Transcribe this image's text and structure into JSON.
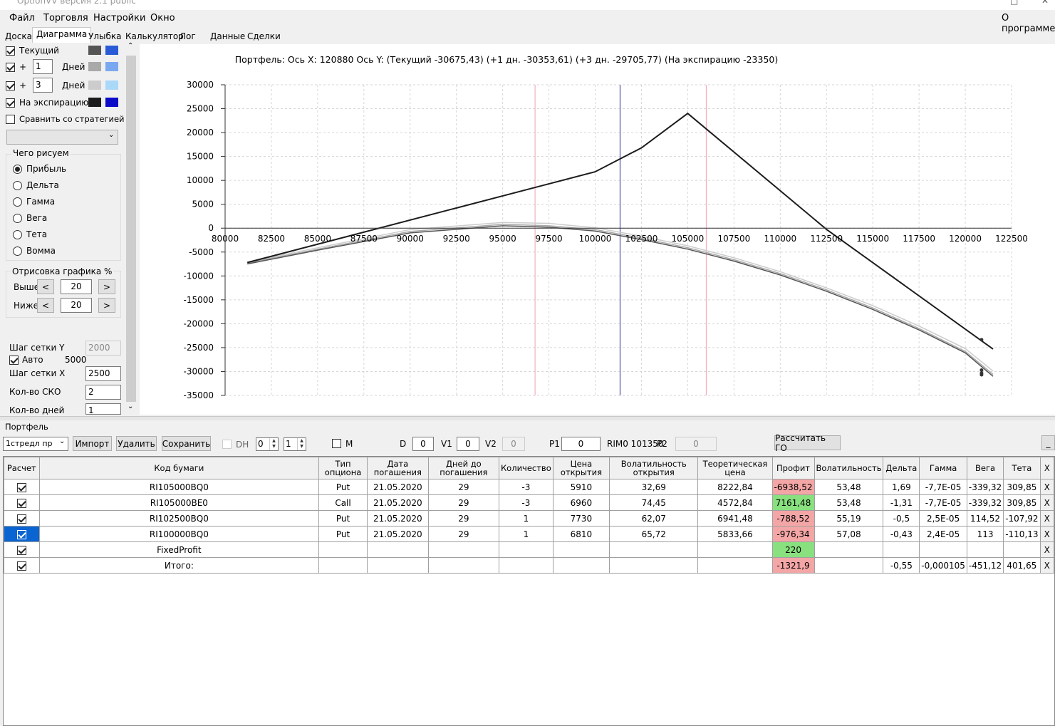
{
  "window": {
    "title": "OptionVV версия 2.1 public"
  },
  "menu": {
    "items": [
      "Файл",
      "Торговля",
      "Настройки",
      "Окно"
    ],
    "about": "О программе"
  },
  "tabs": [
    "Доска",
    "Диаграмма",
    "Улыбка",
    "Калькулятор",
    "Лог",
    "Данные",
    "Сделки"
  ],
  "left": {
    "current_label": "Текущий",
    "plus1": {
      "sign": "+",
      "days": "1",
      "unit": "Дней"
    },
    "plus3": {
      "sign": "+",
      "days": "3",
      "unit": "Дней"
    },
    "expiry_label": "На экспирацию",
    "compare_label": "Сравнить со стратегией",
    "strategy_select": "",
    "draw_group": "Чего рисуем",
    "radios": [
      "Прибыль",
      "Дельта",
      "Гамма",
      "Вега",
      "Тета",
      "Вомма"
    ],
    "render_group": "Отрисовка графика %",
    "above_label": "Выше",
    "above_value": "20",
    "below_label": "Ниже",
    "below_value": "20",
    "prev": "<",
    "next": ">",
    "grid_y_label": "Шаг сетки Y",
    "grid_y_value": "2000",
    "auto_label": "Авто",
    "auto_value": "5000",
    "grid_x_label": "Шаг сетки X",
    "grid_x_value": "2500",
    "sko_label": "Кол-во СКО",
    "sko_value": "2",
    "days_label": "Кол-во дней",
    "days_value": "1",
    "colors": {
      "current": [
        "#555555",
        "#2a5bd7"
      ],
      "plus1": [
        "#a9a9a9",
        "#7aa8f0"
      ],
      "plus3": [
        "#cccccc",
        "#aad8f8"
      ],
      "expiry": [
        "#1c1c1c",
        "#0a0ac8"
      ]
    }
  },
  "chart_data": {
    "type": "line",
    "title": "Портфель: Ось X:  120880 Ось Y:  (Текущий -30675,43)  (+1 дн. -30353,61)  (+3 дн. -29705,77)  (На экспирацию -23350)",
    "xlim": [
      80000,
      122500
    ],
    "ylim": [
      -35000,
      30000
    ],
    "x_ticks": [
      80000,
      82500,
      85000,
      87500,
      90000,
      92500,
      95000,
      97500,
      100000,
      102500,
      105000,
      107500,
      110000,
      112500,
      115000,
      117500,
      120000,
      122500
    ],
    "y_ticks": [
      30000,
      25000,
      20000,
      15000,
      10000,
      5000,
      0,
      -5000,
      -10000,
      -15000,
      -20000,
      -25000,
      -30000,
      -35000
    ],
    "vlines": [
      {
        "x": 96750,
        "color": "#f0a0b0"
      },
      {
        "x": 101350,
        "color": "#8080c0"
      },
      {
        "x": 100850,
        "color": "#f0a0b0",
        "at": 106000
      }
    ],
    "series": [
      {
        "color": "#1c1c1c",
        "points": [
          [
            81200,
            -7200
          ],
          [
            100000,
            11800
          ],
          [
            102500,
            16800
          ],
          [
            105000,
            24000
          ],
          [
            112500,
            -250
          ],
          [
            121500,
            -25300
          ]
        ]
      },
      {
        "color": "#555555",
        "points": [
          [
            81200,
            -7500
          ],
          [
            85000,
            -4600
          ],
          [
            90000,
            -1000
          ],
          [
            95000,
            500
          ],
          [
            97500,
            200
          ],
          [
            100000,
            -600
          ],
          [
            102500,
            -2400
          ],
          [
            105000,
            -4400
          ],
          [
            107500,
            -6900
          ],
          [
            110000,
            -9800
          ],
          [
            112500,
            -13200
          ],
          [
            115000,
            -17000
          ],
          [
            117500,
            -21300
          ],
          [
            120000,
            -26100
          ],
          [
            121500,
            -31000
          ]
        ]
      },
      {
        "color": "#a9a9a9",
        "points": [
          [
            81200,
            -7300
          ],
          [
            85000,
            -4400
          ],
          [
            90000,
            -700
          ],
          [
            95000,
            800
          ],
          [
            97500,
            500
          ],
          [
            100000,
            -300
          ],
          [
            102500,
            -2100
          ],
          [
            105000,
            -4100
          ],
          [
            107500,
            -6600
          ],
          [
            110000,
            -9500
          ],
          [
            112500,
            -12900
          ],
          [
            115000,
            -16700
          ],
          [
            117500,
            -21000
          ],
          [
            120000,
            -25800
          ],
          [
            121500,
            -30600
          ]
        ]
      },
      {
        "color": "#cccccc",
        "points": [
          [
            81200,
            -7100
          ],
          [
            85000,
            -4100
          ],
          [
            90000,
            -300
          ],
          [
            95000,
            1200
          ],
          [
            97500,
            1000
          ],
          [
            100000,
            100
          ],
          [
            102500,
            -1700
          ],
          [
            105000,
            -3700
          ],
          [
            107500,
            -6200
          ],
          [
            110000,
            -9100
          ],
          [
            112500,
            -12500
          ],
          [
            115000,
            -16200
          ],
          [
            117500,
            -20500
          ],
          [
            120000,
            -25200
          ],
          [
            121500,
            -29900
          ]
        ]
      }
    ],
    "markers": [
      [
        120880,
        -23350
      ],
      [
        120880,
        -30675
      ],
      [
        120880,
        -30353
      ],
      [
        120880,
        -29705
      ]
    ]
  },
  "portfolio": {
    "label": "Портфель",
    "strategy": "1стредл пр",
    "import": "Импорт",
    "delete": "Удалить",
    "save": "Сохранить",
    "dh": "DH",
    "spin1": "0",
    "spin2": "1",
    "m": "M",
    "d_label": "D",
    "d_value": "0",
    "v1_label": "V1",
    "v1_value": "0",
    "v2_label": "V2",
    "v2_value": "0",
    "p1_label": "P1",
    "p1_value": "0",
    "rim_label": "RIM0 101350",
    "p2_label": "P2",
    "p2_value": "0",
    "calc_go": "Рассчитать ГО",
    "minimize": "_"
  },
  "table": {
    "headers": [
      "Расчет",
      "Код бумаги",
      "Тип опциона",
      "Дата погашения",
      "Дней до погашения",
      "Количество",
      "Цена открытия",
      "Волатильность открытия",
      "Теоретическая цена",
      "Профит",
      "Волатильность",
      "Дельта",
      "Гамма",
      "Вега",
      "Тета",
      "X"
    ],
    "rows": [
      [
        "RI105000BQ0",
        "Put",
        "21.05.2020",
        "29",
        "-3",
        "5910",
        "32,69",
        "8222,84",
        "-6938,52",
        "53,48",
        "1,69",
        "-7,7E-05",
        "-339,32",
        "309,85",
        "X"
      ],
      [
        "RI105000BE0",
        "Call",
        "21.05.2020",
        "29",
        "-3",
        "6960",
        "74,45",
        "4572,84",
        "7161,48",
        "53,48",
        "-1,31",
        "-7,7E-05",
        "-339,32",
        "309,85",
        "X"
      ],
      [
        "RI102500BQ0",
        "Put",
        "21.05.2020",
        "29",
        "1",
        "7730",
        "62,07",
        "6941,48",
        "-788,52",
        "55,19",
        "-0,5",
        "2,5E-05",
        "114,52",
        "-107,92",
        "X"
      ],
      [
        "RI100000BQ0",
        "Put",
        "21.05.2020",
        "29",
        "1",
        "6810",
        "65,72",
        "5833,66",
        "-976,34",
        "57,08",
        "-0,43",
        "2,4E-05",
        "113",
        "-110,13",
        "X"
      ],
      [
        "FixedProfit",
        "",
        "",
        "",
        "",
        "",
        "",
        "",
        "220",
        "",
        "",
        "",
        "",
        "",
        "X"
      ],
      [
        "Итого:",
        "",
        "",
        "",
        "",
        "",
        "",
        "",
        "-1321,9",
        "",
        "-0,55",
        "-0,000105",
        "-451,12",
        "401,65",
        "X"
      ]
    ],
    "profit_state": [
      "neg",
      "pos",
      "neg",
      "neg",
      "pos",
      "neg"
    ]
  }
}
